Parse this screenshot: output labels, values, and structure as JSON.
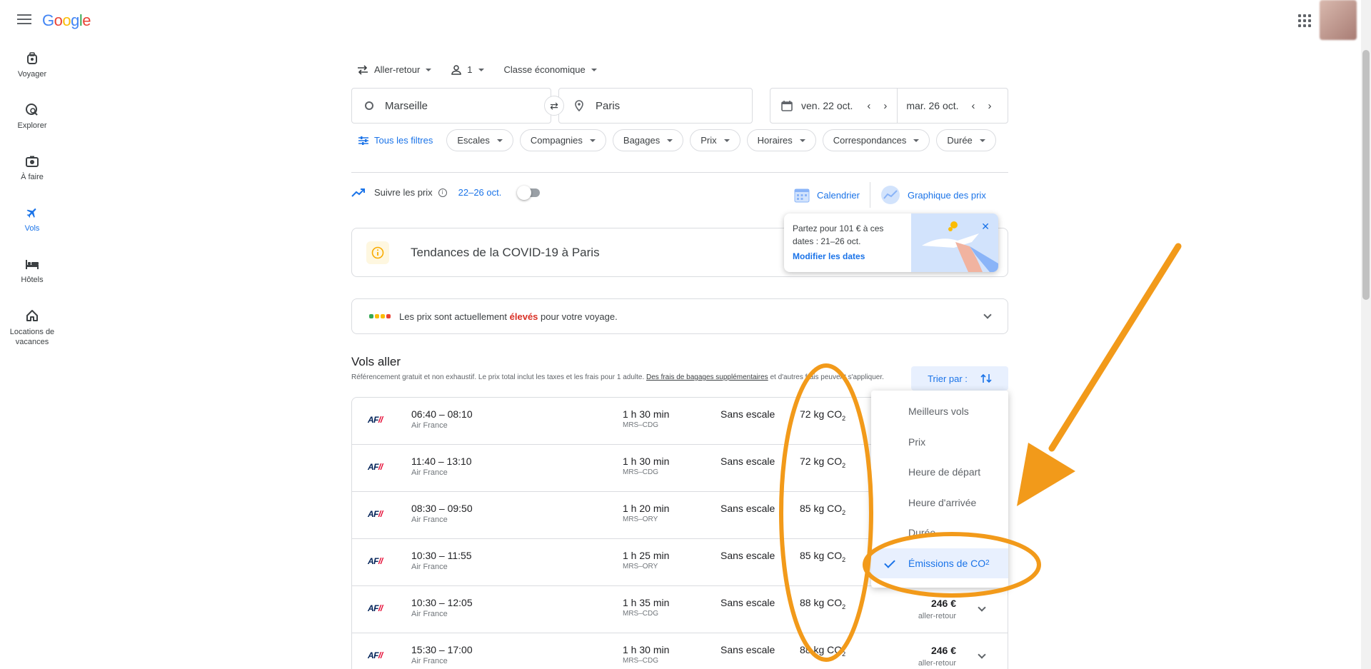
{
  "brand": {
    "logo_text": "Google"
  },
  "sidebar": {
    "items": [
      {
        "label": "Voyager",
        "icon": "suitcase-icon"
      },
      {
        "label": "Explorer",
        "icon": "explore-icon"
      },
      {
        "label": "À faire",
        "icon": "camera-icon"
      },
      {
        "label": "Vols",
        "icon": "plane-icon",
        "active": true
      },
      {
        "label": "Hôtels",
        "icon": "bed-icon"
      },
      {
        "label": "Locations de vacances",
        "icon": "house-icon"
      }
    ]
  },
  "search": {
    "trip_type": "Aller-retour",
    "passengers": "1",
    "cabin_class": "Classe économique",
    "origin": "Marseille",
    "destination": "Paris",
    "depart_date": "ven. 22 oct.",
    "return_date": "mar. 26 oct."
  },
  "filters": {
    "all_label": "Tous les filtres",
    "chips": [
      "Escales",
      "Compagnies",
      "Bagages",
      "Prix",
      "Horaires",
      "Correspondances",
      "Durée"
    ]
  },
  "tracking": {
    "label": "Suivre les prix",
    "dates": "22–26 oct.",
    "calendar_label": "Calendrier",
    "graph_label": "Graphique des prix"
  },
  "tooltip": {
    "text": "Partez pour 101 € à ces dates : 21–26 oct.",
    "link": "Modifier les dates"
  },
  "covid": {
    "title": "Tendances de la COVID-19 à Paris"
  },
  "price_insight": {
    "before": "Les prix sont actuellement ",
    "highlight": "élevés",
    "after": " pour votre voyage."
  },
  "results": {
    "heading": "Vols aller",
    "note_before": "Référencement gratuit et non exhaustif. Le prix total inclut les taxes et les frais pour 1 adulte. ",
    "note_link": "Des frais de bagages supplémentaires",
    "note_after": " et d'autres frais peuvent s'appliquer.",
    "sort_label": "Trier par :",
    "flights": [
      {
        "logo": "AF",
        "times": "06:40 – 08:10",
        "carrier": "Air France",
        "duration": "1 h 30 min",
        "route": "MRS–CDG",
        "stops": "Sans escale",
        "co2": "72 kg CO",
        "price": "",
        "price_type": ""
      },
      {
        "logo": "AF",
        "times": "11:40 – 13:10",
        "carrier": "Air France",
        "duration": "1 h 30 min",
        "route": "MRS–CDG",
        "stops": "Sans escale",
        "co2": "72 kg CO",
        "price": "",
        "price_type": ""
      },
      {
        "logo": "AF",
        "times": "08:30 – 09:50",
        "carrier": "Air France",
        "duration": "1 h 20 min",
        "route": "MRS–ORY",
        "stops": "Sans escale",
        "co2": "85 kg CO",
        "price": "",
        "price_type": ""
      },
      {
        "logo": "AF",
        "times": "10:30 – 11:55",
        "carrier": "Air France",
        "duration": "1 h 25 min",
        "route": "MRS–ORY",
        "stops": "Sans escale",
        "co2": "85 kg CO",
        "price": "",
        "price_type": ""
      },
      {
        "logo": "AF",
        "times": "10:30 – 12:05",
        "carrier": "Air France",
        "duration": "1 h 35 min",
        "route": "MRS–CDG",
        "stops": "Sans escale",
        "co2": "88 kg CO",
        "price": "246 €",
        "price_type": "aller-retour"
      },
      {
        "logo": "AF",
        "times": "15:30 – 17:00",
        "carrier": "Air France",
        "duration": "1 h 30 min",
        "route": "MRS–CDG",
        "stops": "Sans escale",
        "co2": "88 kg CO",
        "price": "246 €",
        "price_type": "aller-retour"
      }
    ]
  },
  "sort_menu": {
    "options": [
      "Meilleurs vols",
      "Prix",
      "Heure de départ",
      "Heure d'arrivée",
      "Durée",
      "Émissions de CO"
    ],
    "selected_index": 5
  },
  "annotation": {
    "color": "#f29a1a"
  }
}
